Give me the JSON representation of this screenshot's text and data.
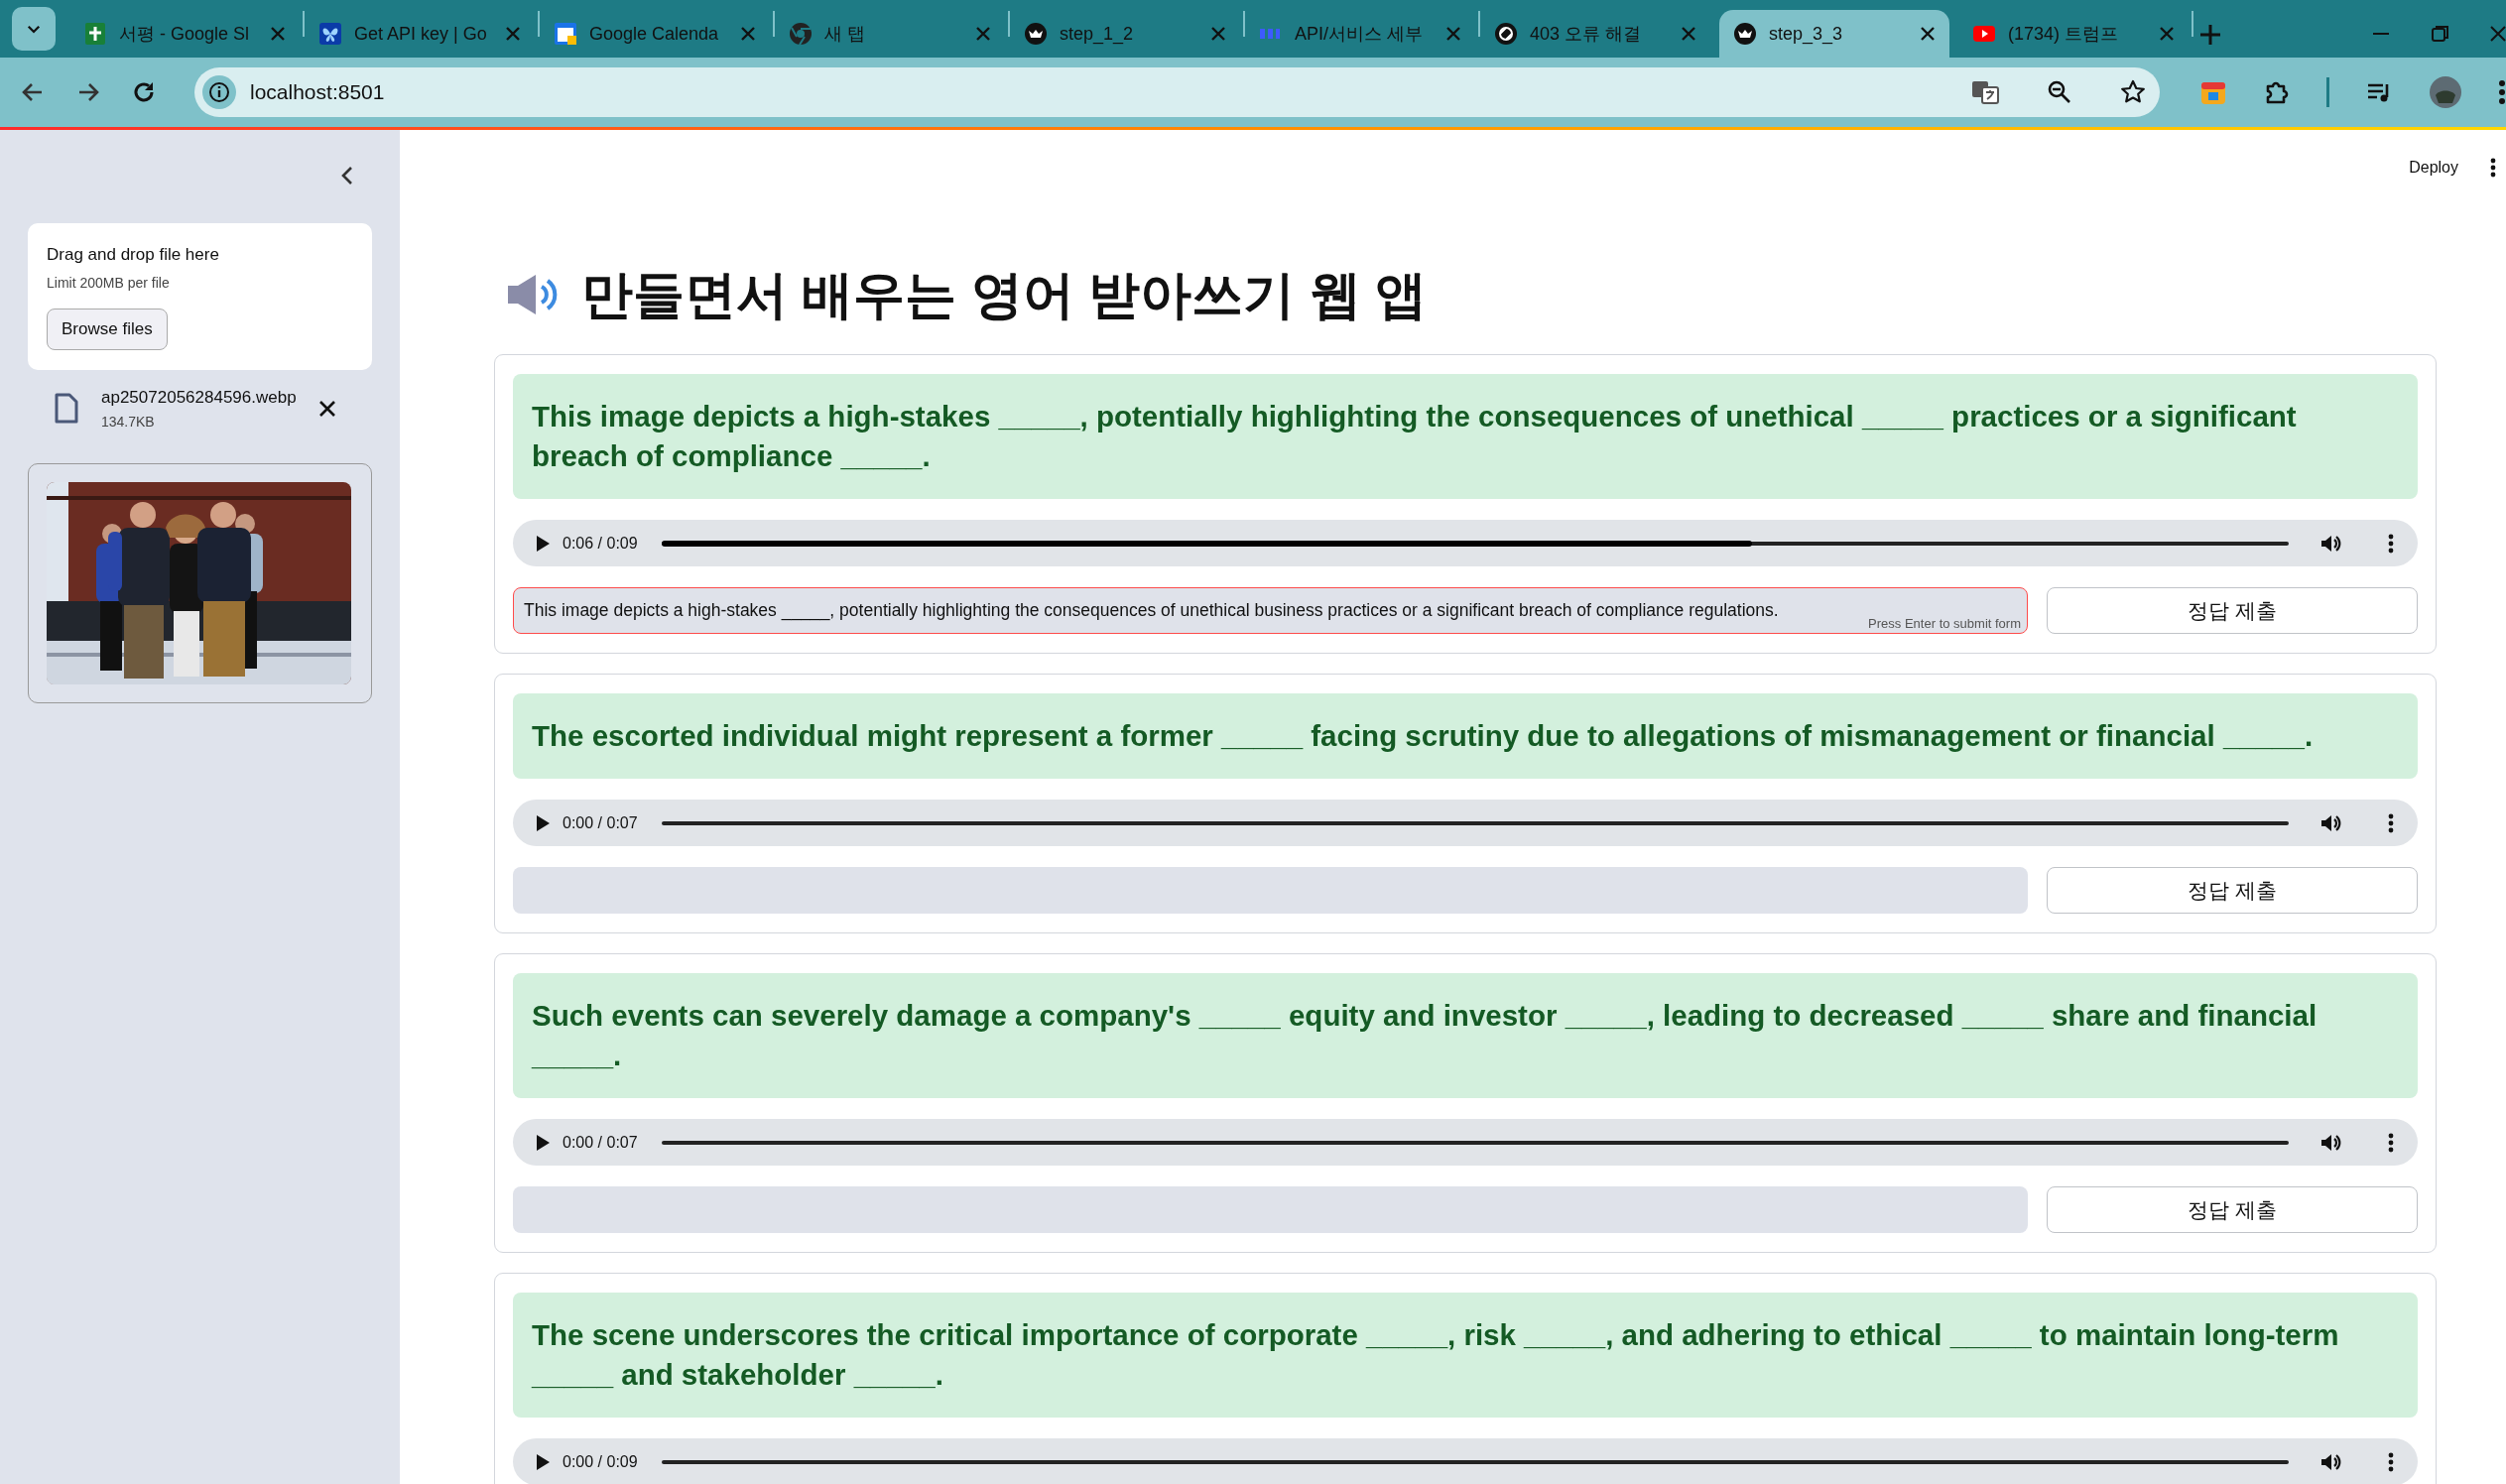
{
  "browser": {
    "tabs": [
      {
        "title": "서평 - Google Sl",
        "kind": "sheets",
        "selected": false
      },
      {
        "title": "Get API key | Go",
        "kind": "butterfly",
        "selected": false
      },
      {
        "title": "Google Calenda",
        "kind": "calendar",
        "selected": false
      },
      {
        "title": "새 탭",
        "kind": "chrome",
        "selected": false
      },
      {
        "title": "step_1_2",
        "kind": "crown",
        "selected": false
      },
      {
        "title": "API/서비스 세부",
        "kind": "api",
        "selected": false
      },
      {
        "title": "403 오류 해결",
        "kind": "knot",
        "selected": false
      },
      {
        "title": "step_3_3",
        "kind": "crown",
        "selected": true
      },
      {
        "title": "(1734) 트럼프",
        "kind": "video",
        "selected": false
      }
    ],
    "url": "localhost:8501"
  },
  "sidebar": {
    "uploader": {
      "title": "Drag and drop file here",
      "limit": "Limit 200MB per file",
      "button": "Browse files"
    },
    "file": {
      "name": "ap25072056284596.webp",
      "size": "134.7KB"
    }
  },
  "header": {
    "deploy": "Deploy"
  },
  "title": "만들면서 배우는 영어 받아쓰기 웹 앱",
  "questions": [
    {
      "sentence": "This image depicts a high-stakes _____, potentially highlighting the consequences of unethical _____ practices or a significant breach of compliance _____.",
      "audio": {
        "time": "0:06 / 0:09",
        "level": 0.67
      },
      "answer": {
        "value": "This image depicts a high-stakes _____, potentially highlighting the consequences of unethical business practices or a significant breach of compliance regulations.",
        "focused": true,
        "hint": "Press Enter to submit form"
      },
      "submit": "정답 제출"
    },
    {
      "sentence": "The escorted individual might represent a former _____ facing scrutiny due to allegations of mismanagement or financial _____.",
      "audio": {
        "time": "0:00 / 0:07"
      },
      "answer": {
        "focused": false
      },
      "submit": "정답 제출"
    },
    {
      "sentence": "Such events can severely damage a company's _____ equity and investor _____, leading to decreased _____ share and financial _____.",
      "audio": {
        "time": "0:00 / 0:07"
      },
      "answer": {
        "focused": false
      },
      "submit": "정답 제출"
    },
    {
      "sentence": "The scene underscores the critical importance of corporate _____, risk _____, and adhering to ethical _____ to maintain long-term _____ and stakeholder _____.",
      "audio": {
        "time": "0:00 / 0:09"
      }
    }
  ]
}
